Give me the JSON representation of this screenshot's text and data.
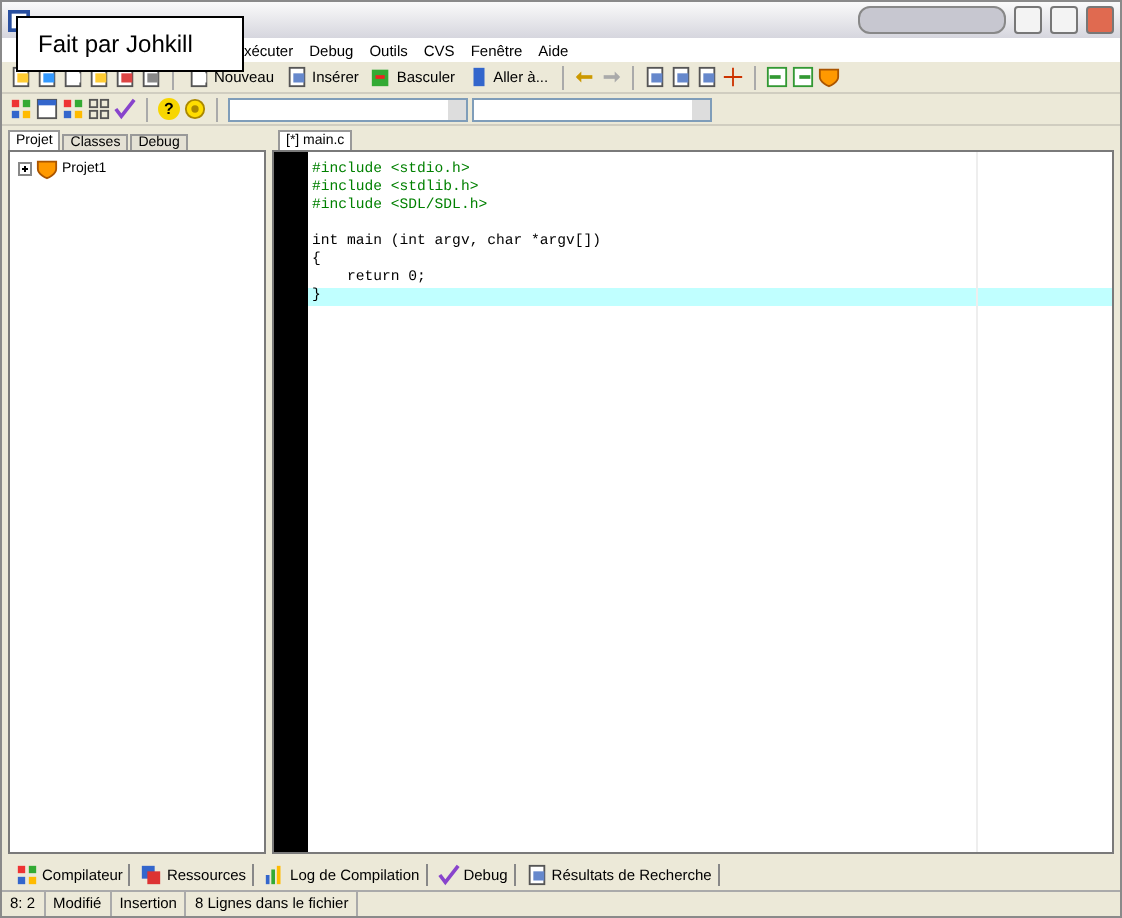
{
  "overlay_note": {
    "text": "Fait par Johkill"
  },
  "menu": [
    "xécuter",
    "Debug",
    "Outils",
    "CVS",
    "Fenêtre",
    "Aide"
  ],
  "toolbar_buttons": [
    "Nouveau",
    "Insérer",
    "Basculer",
    "Aller à..."
  ],
  "help_glyph": "?",
  "project_tabs": [
    {
      "label": "Projet",
      "selected": true
    },
    {
      "label": "Classes",
      "selected": false
    },
    {
      "label": "Debug",
      "selected": false
    }
  ],
  "project_tree": [
    {
      "label": "Projet1",
      "expanded": false
    }
  ],
  "editor_tabs": [
    {
      "label": "[*] main.c",
      "selected": true
    }
  ],
  "code_lines": [
    {
      "text": "#include <stdio.h>",
      "kind": "preprocessor",
      "current": false
    },
    {
      "text": "#include <stdlib.h>",
      "kind": "preprocessor",
      "current": false
    },
    {
      "text": "#include <SDL/SDL.h>",
      "kind": "preprocessor",
      "current": false
    },
    {
      "kind": "blank"
    },
    {
      "text": "int main (int argv, char *argv[])",
      "kind": "code",
      "current": false
    },
    {
      "text": "{",
      "kind": "code",
      "current": false
    },
    {
      "text": "    return 0;",
      "kind": "code",
      "current": false
    },
    {
      "text": "}",
      "kind": "code",
      "current": true
    }
  ],
  "bottom_tabs": [
    "Compilateur",
    "Ressources",
    "Log de Compilation",
    "Debug",
    "Résultats de Recherche"
  ],
  "status_bar": [
    "8: 2",
    "Modifié",
    "Insertion",
    "8 Lignes dans le fichier"
  ]
}
